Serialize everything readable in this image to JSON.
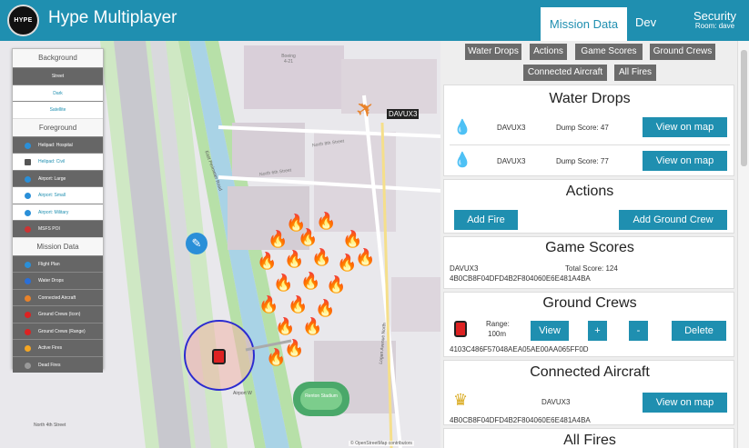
{
  "app": {
    "logo_text": "HYPE",
    "title": "Hype Multiplayer"
  },
  "tabs": {
    "mission_data": "Mission Data",
    "dev": "Dev",
    "security": "Security",
    "room": "Room: dave"
  },
  "layers": {
    "background_header": "Background",
    "background": [
      "Street",
      "Dark",
      "Satellite"
    ],
    "foreground_header": "Foreground",
    "foreground": [
      "Helipad: Hospital",
      "Helipad: Civil",
      "Airport: Large",
      "Airport: Small",
      "Airport: Military",
      "MSFS POI"
    ],
    "mission_header": "Mission Data",
    "mission": [
      "Flight Plan",
      "Water Drops",
      "Connected Aircraft",
      "Ground Crews (Icon)",
      "Ground Crews (Range)",
      "Active Fires",
      "Dead Fires"
    ]
  },
  "map": {
    "aircraft_label": "DAVUX3",
    "attribution": "© OpenStreetMap contributors",
    "streets": [
      "Boeing 4-21",
      "North 8th Street",
      "North 6th Street",
      "East Perimeter Road",
      "Logan Avenue North",
      "Airport W",
      "North 4th Street"
    ],
    "field_label": "Renton Stadium"
  },
  "quick_buttons": [
    "Water Drops",
    "Actions",
    "Game Scores",
    "Ground Crews",
    "Connected Aircraft",
    "All Fires"
  ],
  "water_drops": {
    "title": "Water Drops",
    "rows": [
      {
        "callsign": "DAVUX3",
        "score": "Dump Score: 47",
        "button": "View on map"
      },
      {
        "callsign": "DAVUX3",
        "score": "Dump Score: 77",
        "button": "View on map"
      }
    ]
  },
  "actions": {
    "title": "Actions",
    "add_fire": "Add Fire",
    "add_crew": "Add Ground Crew"
  },
  "game_scores": {
    "title": "Game Scores",
    "callsign": "DAVUX3",
    "total": "Total Score: 124",
    "id": "4B0CB8F04DFD4B2F804060E6E481A4BA"
  },
  "ground_crews": {
    "title": "Ground Crews",
    "range_label": "Range:",
    "range_value": "100m",
    "view": "View",
    "plus": "+",
    "minus": "-",
    "delete": "Delete",
    "id": "4103C486F57048AEA05AE00AA065FF0D"
  },
  "connected_aircraft": {
    "title": "Connected Aircraft",
    "callsign": "DAVUX3",
    "button": "View on map",
    "id": "4B0CB8F04DFD4B2F804060E6E481A4BA"
  },
  "all_fires": {
    "title": "All Fires"
  },
  "colors": {
    "accent": "#1f8fb0",
    "button_gray": "#6b6b6b",
    "water": "#1a6fd0"
  }
}
